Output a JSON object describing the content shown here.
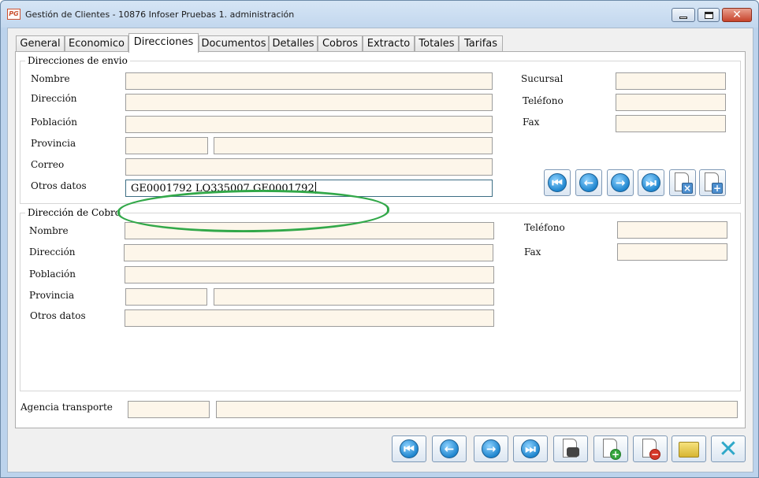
{
  "window": {
    "app_icon_text": "PG",
    "title": "Gestión de Clientes - 10876 Infoser Pruebas 1. administración"
  },
  "tabs": [
    {
      "label": "General"
    },
    {
      "label": "Economico"
    },
    {
      "label": "Direcciones",
      "active": true
    },
    {
      "label": "Documentos"
    },
    {
      "label": "Detalles"
    },
    {
      "label": "Cobros"
    },
    {
      "label": "Extracto"
    },
    {
      "label": "Totales"
    },
    {
      "label": "Tarifas"
    }
  ],
  "envio": {
    "title": "Direcciones de envio",
    "labels": {
      "nombre": "Nombre",
      "direccion": "Dirección",
      "poblacion": "Población",
      "provincia": "Provincia",
      "correo": "Correo",
      "otros": "Otros datos",
      "sucursal": "Sucursal",
      "telefono": "Teléfono",
      "fax": "Fax"
    },
    "values": {
      "nombre": "",
      "direccion": "",
      "poblacion": "",
      "provincia_code": "",
      "provincia_name": "",
      "correo": "",
      "otros": "GE0001792 LO335007 GE0001792",
      "sucursal": "",
      "telefono": "",
      "fax": ""
    }
  },
  "cobro": {
    "title": "Dirección de Cobro",
    "labels": {
      "nombre": "Nombre",
      "direccion": "Dirección",
      "poblacion": "Población",
      "provincia": "Provincia",
      "otros": "Otros datos",
      "telefono": "Teléfono",
      "fax": "Fax"
    },
    "values": {
      "nombre": "",
      "direccion": "",
      "poblacion": "",
      "provincia_code": "",
      "provincia_name": "",
      "otros": "",
      "telefono": "",
      "fax": ""
    }
  },
  "agencia": {
    "label": "Agencia transporte",
    "code": "",
    "name": ""
  },
  "icons": {
    "first": "first-record-icon",
    "prev": "previous-record-icon",
    "next": "next-record-icon",
    "last": "last-record-icon",
    "delete_address": "delete-address-icon",
    "add_address": "add-address-icon",
    "search": "binoculars-search-icon",
    "new": "new-document-icon",
    "delete": "delete-document-icon",
    "export": "export-folder-icon",
    "close": "close-icon"
  },
  "colors": {
    "field_bg": "#fdf6ea",
    "annotation": "#32a849",
    "nav_circle": "#1f86cf"
  }
}
